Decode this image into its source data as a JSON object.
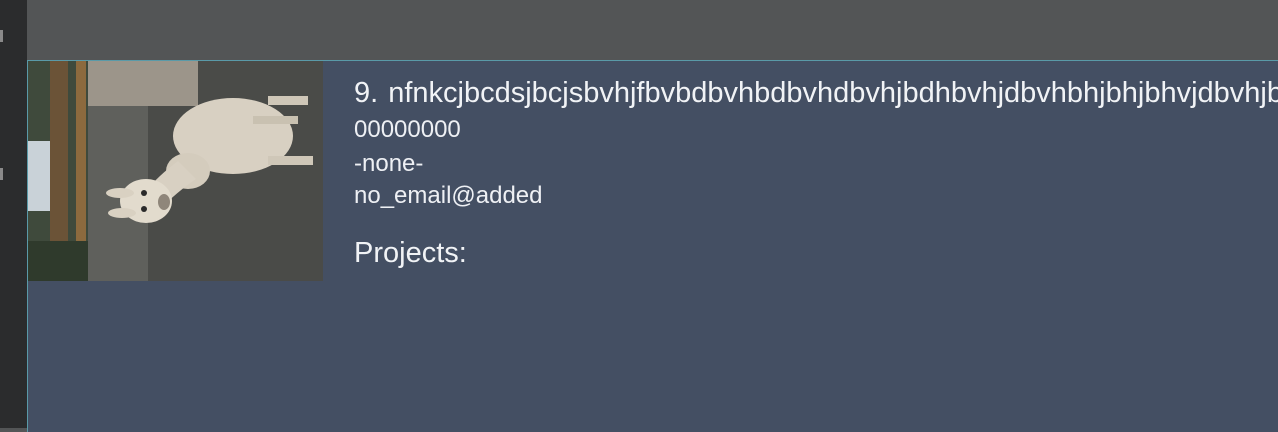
{
  "person": {
    "index": "9.",
    "name": "nfnkcjbcdsjbcjsbvhjfbvbdbvhbdbvhdbvhjbdhbvhjdbvhbhjbhjbhvjdbvhjbdhvbhjdbvhjbdhbvhjdbvhjbdhvbdbv",
    "phone": "00000000",
    "address": "-none-",
    "email": "no_email@added",
    "projects_label": "Projects:"
  },
  "photo": {
    "subject": "alpaca"
  }
}
